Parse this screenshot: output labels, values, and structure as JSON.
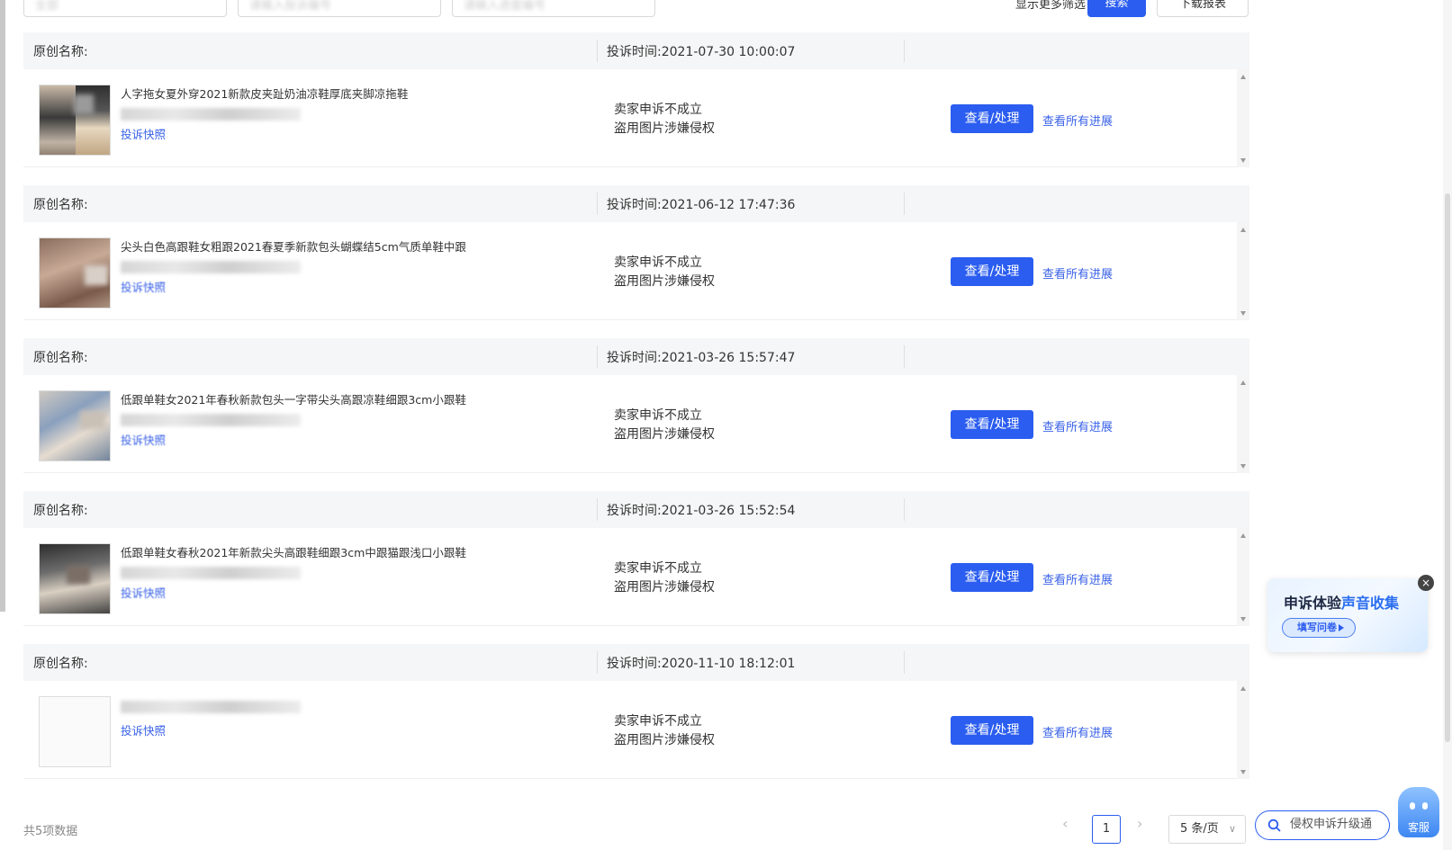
{
  "filters": {
    "field1_value": "全部",
    "field2_placeholder": "请输入投诉编号",
    "field3_placeholder": "请输入进度编号",
    "expand_link": "显示更多筛选",
    "search_label": "搜索",
    "export_label": "下载报表"
  },
  "complaints": [
    {
      "original_name_label": "原创名称:",
      "time_label": "投诉时间:2021-07-30 10:00:07",
      "product_title": "人字拖女夏外穿2021新款皮夹趾奶油凉鞋厚底夹脚凉拖鞋",
      "snapshot_label": "投诉快照",
      "status_line1": "卖家申诉不成立",
      "status_line2": "盗用图片涉嫌侵权",
      "view_label": "查看/处理",
      "progress_label": "查看所有进展"
    },
    {
      "original_name_label": "原创名称:",
      "time_label": "投诉时间:2021-06-12 17:47:36",
      "product_title": "尖头白色高跟鞋女粗跟2021春夏季新款包头蝴蝶结5cm气质单鞋中跟",
      "snapshot_label": "投诉快照",
      "status_line1": "卖家申诉不成立",
      "status_line2": "盗用图片涉嫌侵权",
      "view_label": "查看/处理",
      "progress_label": "查看所有进展"
    },
    {
      "original_name_label": "原创名称:",
      "time_label": "投诉时间:2021-03-26 15:57:47",
      "product_title": "低跟单鞋女2021年春秋新款包头一字带尖头高跟凉鞋细跟3cm小跟鞋",
      "snapshot_label": "投诉快照",
      "status_line1": "卖家申诉不成立",
      "status_line2": "盗用图片涉嫌侵权",
      "view_label": "查看/处理",
      "progress_label": "查看所有进展"
    },
    {
      "original_name_label": "原创名称:",
      "time_label": "投诉时间:2021-03-26 15:52:54",
      "product_title": "低跟单鞋女春秋2021年新款尖头高跟鞋细跟3cm中跟猫跟浅口小跟鞋",
      "snapshot_label": "投诉快照",
      "status_line1": "卖家申诉不成立",
      "status_line2": "盗用图片涉嫌侵权",
      "view_label": "查看/处理",
      "progress_label": "查看所有进展"
    },
    {
      "original_name_label": "原创名称:",
      "time_label": "投诉时间:2020-11-10 18:12:01",
      "product_title": "",
      "snapshot_label": "投诉快照",
      "status_line1": "卖家申诉不成立",
      "status_line2": "盗用图片涉嫌侵权",
      "view_label": "查看/处理",
      "progress_label": "查看所有进展"
    }
  ],
  "footer": {
    "total_label": "共5项数据",
    "prev_icon": "‹",
    "current_page": "1",
    "next_icon": "›",
    "page_size": "5 条/页",
    "page_size_chevron": "∨"
  },
  "upgrade": {
    "label": "侵权申诉升级通"
  },
  "survey": {
    "title_part1": "申诉体验",
    "title_part2": "声音收集",
    "button_label": "填写问卷",
    "close_label": "×"
  },
  "service": {
    "label": "客服"
  },
  "colors": {
    "primary": "#2b5df0",
    "link": "#3a62e8"
  }
}
